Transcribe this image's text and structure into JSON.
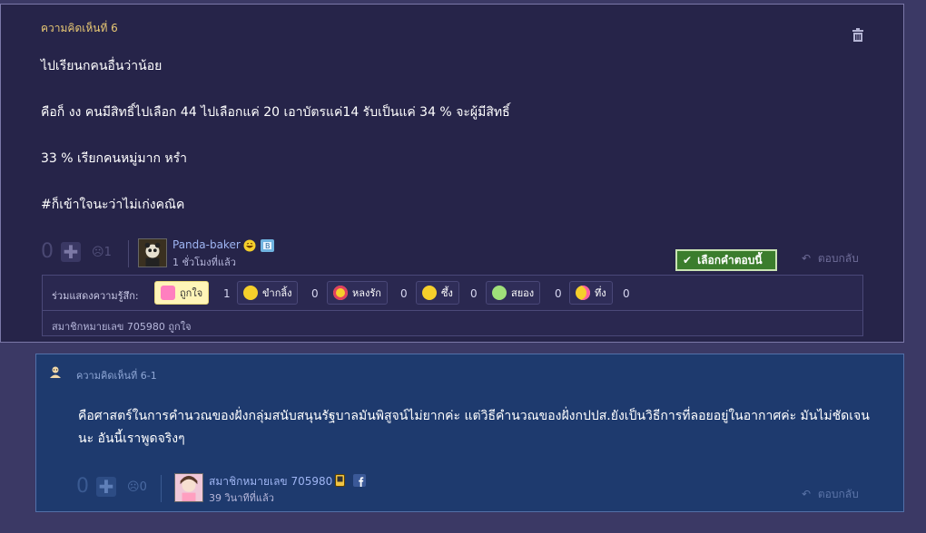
{
  "main_comment": {
    "title": "ความคิดเห็นที่ 6",
    "body": [
      "ไปเรียนกคนอื่นว่าน้อย",
      "คือก็ งง  คนมีสิทธิ์ไปเลือก 44  ไปเลือกแค่ 20  เอาบัตรแค่14  รับเป็นแค่ 34 % จะผู้มีสิทธิ์",
      "33 % เรียกคนหมู่มาก หรํา",
      "#ก็เข้าใจนะว่าไม่เก่งคณิค"
    ],
    "vote_count": "0",
    "dislike_count": "1",
    "username": "Panda-baker",
    "time": "1 ชั่วโมงที่แล้ว",
    "choose_answer_label": "เลือกคำตอบนี้",
    "reply_label": "ตอบกลับ",
    "feelings_label": "ร่วมแสดงความรู้สึก:",
    "feelings": [
      {
        "label": "ถูกใจ",
        "count": "1"
      },
      {
        "label": "ขำกลิ้ง",
        "count": "0"
      },
      {
        "label": "หลงรัก",
        "count": "0"
      },
      {
        "label": "ซึ้ง",
        "count": "0"
      },
      {
        "label": "สยอง",
        "count": "0"
      },
      {
        "label": "ทึ่ง",
        "count": "0"
      }
    ],
    "feelings_footer": "สมาชิกหมายเลข 705980 ถูกใจ"
  },
  "reply_comment": {
    "title": "ความคิดเห็นที่ 6-1",
    "body": "คือศาสตร์ในการคำนวณของฝั่งกลุ่มสนับสนุนรัฐบาลมันพิสูจน์ไม่ยากค่ะ แต่วิธีคำนวณของฝั่งกปปส.ยังเป็นวิธีการที่ลอยอยู่ในอากาศค่ะ มันไม่ชัดเจนนะ อันนี้เราพูดจริงๆ",
    "vote_count": "0",
    "dislike_count": "0",
    "username": "สมาชิกหมายเลข 705980",
    "time": "39 วินาทีที่แล้ว",
    "reply_label": "ตอบกลับ"
  },
  "colors": {
    "main_bg": "#262449",
    "reply_bg": "#1e3a6e",
    "accent_green": "#3b7d2d",
    "title_gold": "#e8c874"
  }
}
